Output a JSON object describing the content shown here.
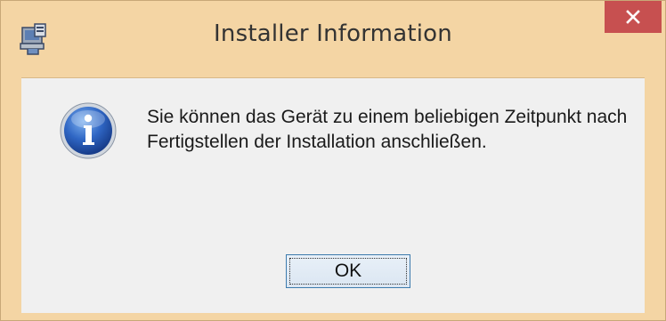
{
  "window": {
    "title": "Installer Information",
    "frame_color": "#f4d5a4",
    "close_button_color": "#c75050"
  },
  "titlebar": {
    "app_icon": "installer-icon",
    "close_icon": "close-x-icon"
  },
  "dialog": {
    "icon": "information-icon",
    "message_line1": "Sie können das Gerät zu einem beliebigen Zeitpunkt nach",
    "message_line2": "Fertigstellen der Installation anschließen.",
    "ok_label": "OK"
  }
}
